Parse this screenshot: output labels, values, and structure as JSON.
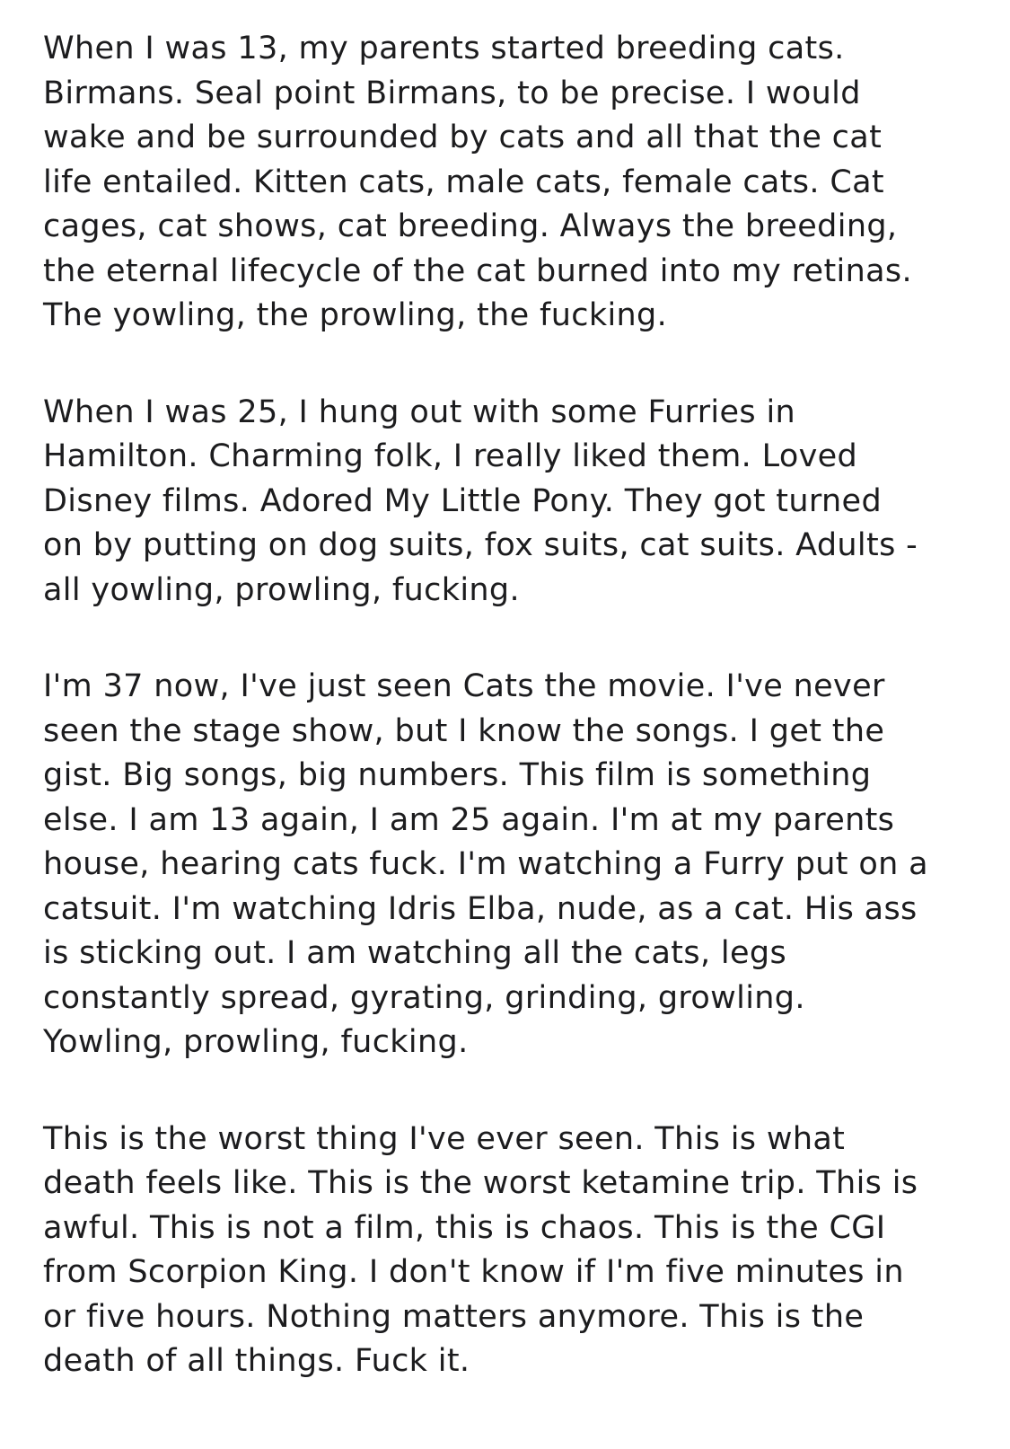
{
  "note": {
    "paragraphs": [
      [
        "When I was 13, my parents started breeding cats.",
        "Birmans. Seal point Birmans, to be precise. I would",
        "wake and be surrounded by cats and all that the cat",
        "life entailed. Kitten cats, male cats, female cats. Cat",
        "cages, cat shows, cat breeding. Always the breeding,",
        "the eternal lifecycle of the cat burned into my retinas.",
        "The yowling, the prowling, the fucking."
      ],
      [
        "When I was 25, I hung out with some Furries in",
        "Hamilton. Charming folk, I really liked them. Loved",
        "Disney films. Adored My Little Pony. They got turned",
        "on by putting on dog suits, fox suits, cat suits. Adults -",
        "all yowling, prowling, fucking."
      ],
      [
        "I'm 37 now, I've just seen Cats the movie. I've never",
        "seen the stage show, but I know the songs. I get the",
        "gist. Big songs, big numbers. This film is something",
        "else. I am 13 again, I am 25 again. I'm at my parents",
        "house, hearing cats fuck. I'm watching a Furry put on a",
        "catsuit. I'm watching Idris Elba, nude, as a cat. His ass",
        "is sticking out. I am watching all the cats, legs",
        "constantly spread, gyrating, grinding, growling.",
        "Yowling, prowling, fucking."
      ],
      [
        "This is the worst thing I've ever seen. This is what",
        "death feels like. This is the worst ketamine trip. This is",
        "awful. This is not a film, this is chaos. This is the CGI",
        "from Scorpion King. I don't know if I'm five minutes in",
        "or five hours. Nothing matters anymore. This is the",
        "death of all things. Fuck it."
      ]
    ]
  }
}
